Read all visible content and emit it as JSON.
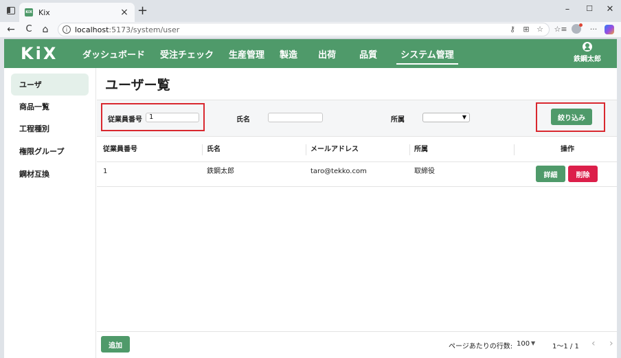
{
  "browser": {
    "tab_title": "Kix",
    "tab_favicon": "KIX",
    "tab_close": "×",
    "new_tab": "+",
    "url_host": "localhost",
    "url_path": ":5173/system/user",
    "win_minimize": "–",
    "win_maximize": "☐",
    "win_close": "✕",
    "icons": {
      "back": "←",
      "reload": "C",
      "home": "⌂",
      "info": "i",
      "key": "⚷",
      "app_grid": "⊞",
      "star": "☆",
      "favorites": "☆≡",
      "more": "···"
    }
  },
  "app": {
    "logo": "KiX",
    "nav": [
      {
        "label": "ダッシュボード",
        "active": false
      },
      {
        "label": "受注チェック",
        "active": false
      },
      {
        "label": "生産管理",
        "active": false
      },
      {
        "label": "製造",
        "active": false
      },
      {
        "label": "出荷",
        "active": false
      },
      {
        "label": "品質",
        "active": false
      },
      {
        "label": "システム管理",
        "active": true
      }
    ],
    "user_name": "鉄鋼太郎",
    "colors": {
      "brand": "#4f9a6a",
      "danger": "#dc1f4a",
      "highlight": "#d9272e",
      "sidebar_active": "#e4f0ea"
    }
  },
  "sidebar": {
    "items": [
      {
        "label": "ユーザ",
        "active": true
      },
      {
        "label": "商品一覧",
        "active": false
      },
      {
        "label": "工程種別",
        "active": false
      },
      {
        "label": "権限グループ",
        "active": false
      },
      {
        "label": "鋼材互換",
        "active": false
      }
    ]
  },
  "page": {
    "title": "ユーザー覧",
    "filters": {
      "employee_no_label": "従業員番号",
      "employee_no_value": "1",
      "name_label": "氏名",
      "name_value": "",
      "dept_label": "所属",
      "dept_value": "",
      "dept_chevron": "▼",
      "submit_label": "絞り込み"
    },
    "table": {
      "columns": [
        "従業員番号",
        "氏名",
        "メールアドレス",
        "所属",
        "操作"
      ],
      "rows": [
        {
          "employee_no": "1",
          "name": "鉄鋼太郎",
          "email": "taro@tekko.com",
          "dept": "取締役",
          "detail_label": "詳細",
          "delete_label": "削除"
        }
      ]
    },
    "footer": {
      "add_label": "追加",
      "rows_per_page_label": "ページあたりの行数:",
      "rows_per_page_value": "100",
      "rows_per_page_chevron": "▼",
      "range": "1〜1 / 1",
      "prev": "‹",
      "next": "›"
    }
  }
}
